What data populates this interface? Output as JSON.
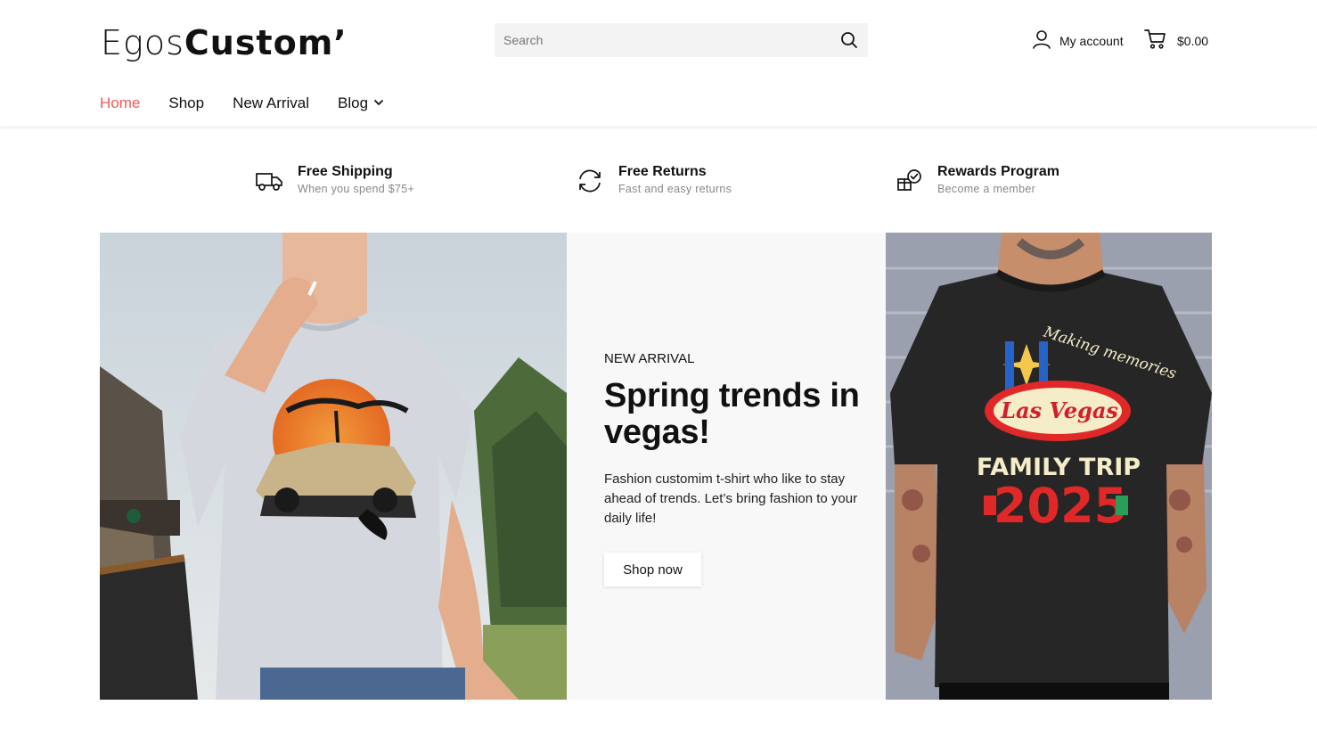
{
  "brand": {
    "logo_thin": "Egos",
    "logo_bold": "Custom’"
  },
  "search": {
    "placeholder": "Search"
  },
  "account": {
    "label": "My account"
  },
  "cart": {
    "total": "$0.00"
  },
  "nav": {
    "items": [
      {
        "label": "Home",
        "active": true
      },
      {
        "label": "Shop"
      },
      {
        "label": "New Arrival"
      },
      {
        "label": "Blog",
        "has_dropdown": true
      }
    ]
  },
  "features": [
    {
      "icon": "truck-icon",
      "title": "Free Shipping",
      "subtitle": "When you spend $75+"
    },
    {
      "icon": "refresh-icon",
      "title": "Free Returns",
      "subtitle": "Fast and easy returns"
    },
    {
      "icon": "gift-check-icon",
      "title": "Rewards Program",
      "subtitle": "Become a member"
    }
  ],
  "hero": {
    "kicker": "NEW ARRIVAL",
    "headline": "Spring trends in vegas!",
    "description": "Fashion customim t-shirt who like to stay ahead of trends. Let’s bring fashion to your daily life!",
    "cta": "Shop now",
    "right_shirt": {
      "script_text": "Making memories",
      "sign_text": "Las Vegas",
      "line1": "FAMILY TRIP",
      "line2": "2025"
    }
  },
  "colors": {
    "accent": "#e85d55",
    "text": "#111111",
    "muted": "#888888",
    "panel": "#f8f8f8"
  }
}
